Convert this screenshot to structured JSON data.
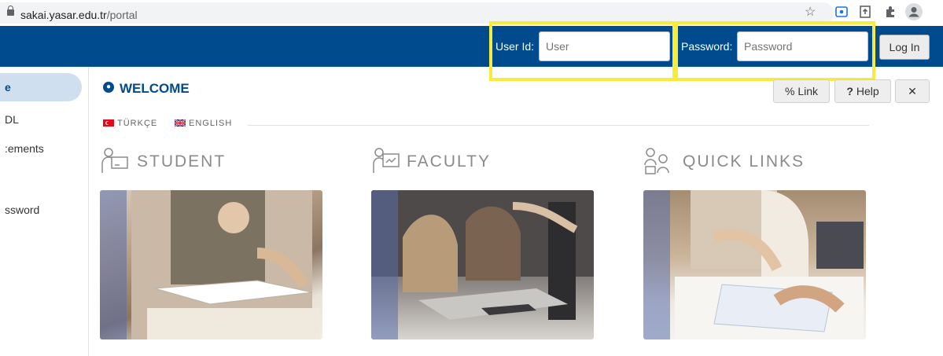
{
  "browser": {
    "url_domain": "sakai.yasar.edu.tr",
    "url_path": "/portal",
    "icons": [
      "star-icon",
      "screencast-icon",
      "share-icon",
      "extensions-icon",
      "profile-icon"
    ]
  },
  "login": {
    "user_label": "User Id:",
    "user_placeholder": "User",
    "password_label": "Password:",
    "password_placeholder": "Password",
    "button_label": "Log In"
  },
  "sidebar": {
    "items": [
      {
        "label": "e",
        "active": true
      },
      {
        "label": "DL"
      },
      {
        "label": ":ements"
      },
      {
        "label": "ssword"
      }
    ]
  },
  "main": {
    "title": "WELCOME",
    "tools": {
      "link": "Link",
      "help": "Help"
    },
    "languages": [
      "TÜRKÇE",
      "ENGLISH"
    ],
    "categories": [
      {
        "title": "STUDENT",
        "icon": "student-icon"
      },
      {
        "title": "FACULTY",
        "icon": "faculty-icon"
      },
      {
        "title": "QUICK LINKS",
        "icon": "quick-links-icon"
      }
    ]
  },
  "colors": {
    "brand": "#004b8d",
    "highlight": "#f7ec3b",
    "muted": "#8b8b8b"
  }
}
